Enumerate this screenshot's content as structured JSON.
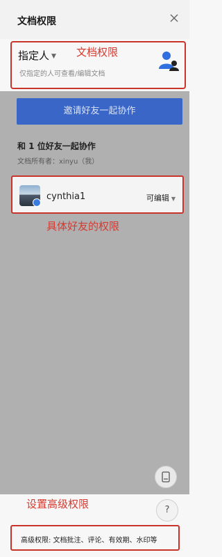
{
  "header": {
    "title": "文档权限"
  },
  "permission": {
    "selected": "指定人",
    "hint": "仅指定的人可查看/编辑文档"
  },
  "invite_button": "邀请好友一起协作",
  "collaborators": {
    "title": "和 1 位好友一起协作",
    "owner": "文档所有者：xinyu（我）"
  },
  "friend": {
    "name": "cynthia1",
    "permission": "可编辑"
  },
  "annotations": {
    "doc_permission": "文档权限",
    "friend_permission": "具体好友的权限",
    "advanced": "设置高级权限"
  },
  "advanced_text": "高级权限: 文档批注、评论、有效期、水印等",
  "help_label": "?",
  "colors": {
    "accent": "#3a66c7",
    "annotation": "#d43a2f",
    "overlay": "#b0b0b0"
  }
}
